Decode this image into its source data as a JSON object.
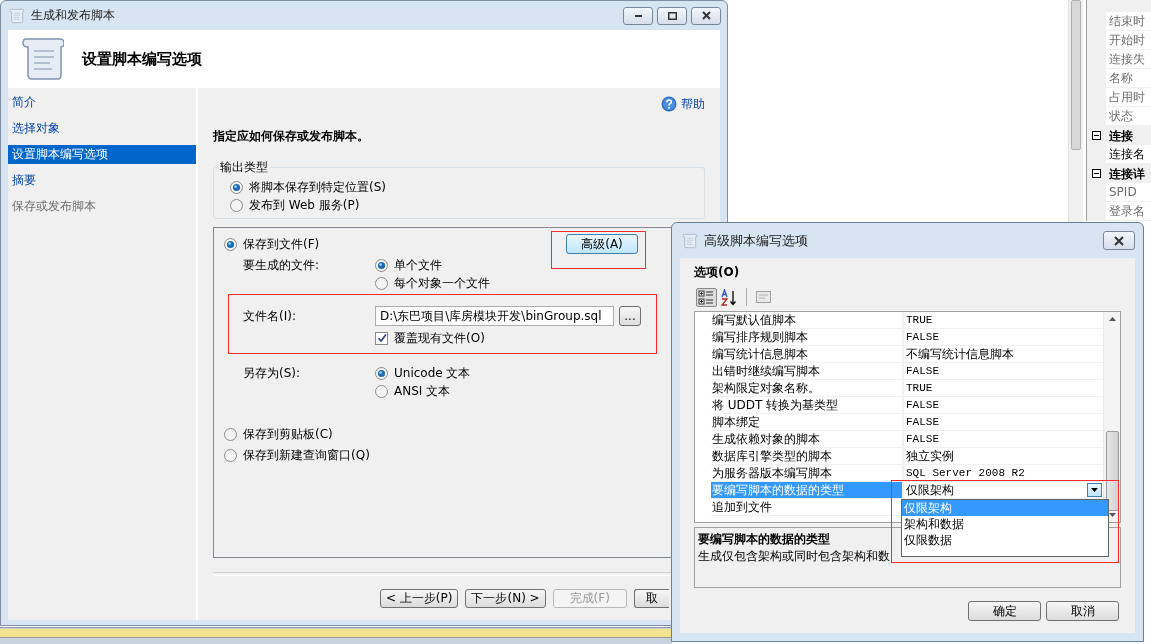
{
  "main_window": {
    "title": "生成和发布脚本",
    "header": "设置脚本编写选项",
    "nav": [
      {
        "label": "简介",
        "selected": false,
        "disabled": false
      },
      {
        "label": "选择对象",
        "selected": false,
        "disabled": false
      },
      {
        "label": "设置脚本编写选项",
        "selected": true,
        "disabled": false
      },
      {
        "label": "摘要",
        "selected": false,
        "disabled": false
      },
      {
        "label": "保存或发布脚本",
        "selected": false,
        "disabled": true
      }
    ],
    "help": "帮助",
    "instruction": "指定应如何保存或发布脚本。",
    "output_type": {
      "legend": "输出类型",
      "options": [
        {
          "label": "将脚本保存到特定位置(S)",
          "selected": true
        },
        {
          "label": "发布到 Web 服务(P)",
          "selected": false
        }
      ]
    },
    "save_to_file": {
      "label": "保存到文件(F)",
      "selected": true
    },
    "advanced_button": "高级(A)",
    "files_label": "要生成的文件:",
    "files_options": [
      {
        "label": "单个文件",
        "selected": true
      },
      {
        "label": "每个对象一个文件",
        "selected": false
      }
    ],
    "filename_label": "文件名(I):",
    "filename_value": "D:\\东巴项目\\库房模块开发\\binGroup.sql",
    "browse_button": "...",
    "overwrite": {
      "label": "覆盖现有文件(O)",
      "checked": true
    },
    "save_as_label": "另存为(S):",
    "save_as_options": [
      {
        "label": "Unicode 文本",
        "selected": true
      },
      {
        "label": "ANSI 文本",
        "selected": false
      }
    ],
    "other_destinations": [
      {
        "label": "保存到剪贴板(C)",
        "selected": false
      },
      {
        "label": "保存到新建查询窗口(Q)",
        "selected": false
      }
    ],
    "buttons": [
      {
        "label": "< 上一步(P)",
        "disabled": false
      },
      {
        "label": "下一步(N) >",
        "disabled": false
      },
      {
        "label": "完成(F)",
        "disabled": true
      },
      {
        "label": "取",
        "disabled": false
      }
    ]
  },
  "advanced_dialog": {
    "title": "高级脚本编写选项",
    "options_label": "选项(O)",
    "toolbar": [
      {
        "kind": "categorized",
        "pressed": true
      },
      {
        "kind": "alphabetical",
        "pressed": false
      },
      {
        "kind": "property-pages",
        "pressed": false
      }
    ],
    "rows": [
      {
        "name": "编写默认值脚本",
        "value": "TRUE",
        "selected": false
      },
      {
        "name": "编写排序规则脚本",
        "value": "FALSE",
        "selected": false
      },
      {
        "name": "编写统计信息脚本",
        "value": "不编写统计信息脚本",
        "selected": false
      },
      {
        "name": "出错时继续编写脚本",
        "value": "FALSE",
        "selected": false
      },
      {
        "name": "架构限定对象名称。",
        "value": "TRUE",
        "selected": false
      },
      {
        "name": "将 UDDT 转换为基类型",
        "value": "FALSE",
        "selected": false
      },
      {
        "name": "脚本绑定",
        "value": "FALSE",
        "selected": false
      },
      {
        "name": "生成依赖对象的脚本",
        "value": "FALSE",
        "selected": false
      },
      {
        "name": "数据库引擎类型的脚本",
        "value": "独立实例",
        "selected": false
      },
      {
        "name": "为服务器版本编写脚本",
        "value": "SQL Server 2008 R2",
        "selected": false
      },
      {
        "name": "要编写脚本的数据的类型",
        "value": "仅限架构",
        "selected": true
      },
      {
        "name": "追加到文件",
        "selected": false
      }
    ],
    "dropdown": [
      {
        "label": "仅限架构",
        "selected": true
      },
      {
        "label": "架构和数据",
        "selected": false
      },
      {
        "label": "仅限数据",
        "selected": false
      }
    ],
    "description_title": "要编写脚本的数据的类型",
    "description": "生成仅包含架构或同时包含架构和数",
    "buttons": [
      "确定",
      "取消"
    ]
  },
  "background_panel": {
    "rows": [
      {
        "kind": "property",
        "name": "结束时",
        "disabled": true
      },
      {
        "kind": "property",
        "name": "开始时",
        "disabled": true
      },
      {
        "kind": "property",
        "name": "连接失",
        "disabled": true
      },
      {
        "kind": "property",
        "name": "名称",
        "disabled": true
      },
      {
        "kind": "property",
        "name": "占用时",
        "disabled": true
      },
      {
        "kind": "property",
        "name": "状态",
        "disabled": true
      },
      {
        "kind": "category",
        "name": "连接",
        "expanded": true
      },
      {
        "kind": "property",
        "name": "连接名",
        "disabled": false
      },
      {
        "kind": "category",
        "name": "连接详",
        "expanded": true
      },
      {
        "kind": "property",
        "name": "SPID",
        "disabled": true
      },
      {
        "kind": "property",
        "name": "登录名",
        "disabled": true
      }
    ]
  }
}
